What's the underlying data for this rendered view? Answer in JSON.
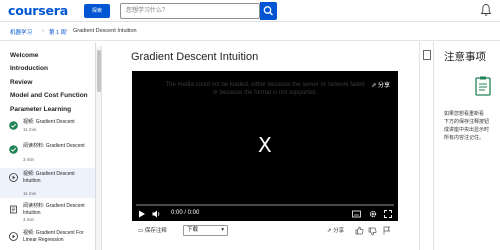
{
  "header": {
    "logo": "coursera",
    "explore_label": "探索",
    "search_placeholder": "您想学习什么？"
  },
  "breadcrumb": [
    "机器学习",
    "第 1 周",
    "Gradient Descent Intuition"
  ],
  "sidebar": {
    "sections": [
      "Welcome",
      "Introduction",
      "Review",
      "Model and Cost Function",
      "Parameter Learning"
    ],
    "items": [
      {
        "title": "视频: Gradient Descent",
        "duration": "11 min",
        "icon": "check-icon",
        "status": "completed"
      },
      {
        "title": "阅读材料: Gradient Descent",
        "duration": "3 min",
        "icon": "check-icon",
        "status": "completed"
      },
      {
        "title": "视频: Gradient Descent Intuition",
        "duration": "11 min",
        "icon": "play-icon",
        "status": "current"
      },
      {
        "title": "阅读材料: Gradient Descent Intuition",
        "duration": "3 min",
        "icon": "reading-icon",
        "status": "pending"
      },
      {
        "title": "视频: Gradient Descent For Linear Regression",
        "duration": "",
        "icon": "play-icon",
        "status": "pending"
      }
    ]
  },
  "main": {
    "title": "Gradient Descent Intuition",
    "video": {
      "error": "The media could not be loaded, either because the server or network failed or because the format is not supported.",
      "share_label": "分享",
      "big_symbol": "X",
      "time": "0:00 / 0:00"
    },
    "below": {
      "save_notes": "保存注释",
      "download_label": "下载",
      "share_label": "分享"
    }
  },
  "notes_panel": {
    "title": "注意事项",
    "text": "如果您想看重新看\n下方的保存注释按钮\n成讲座中央出显示时\n所有内容注记住。"
  },
  "colors": {
    "brand": "#0056d2",
    "player_bg": "#000000",
    "complete": "#1f8354"
  }
}
